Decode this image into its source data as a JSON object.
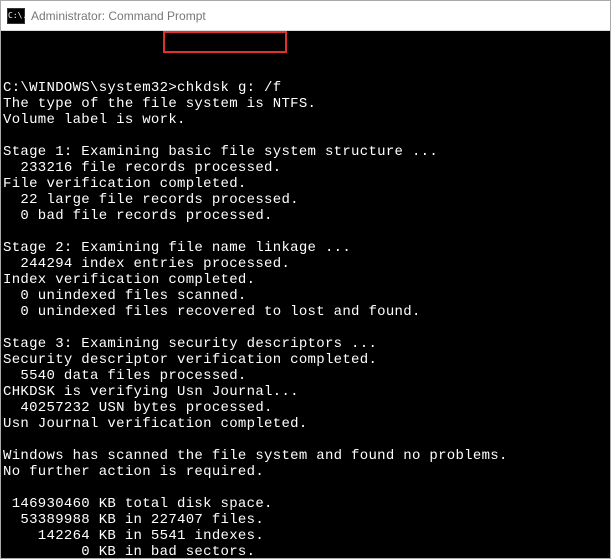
{
  "window": {
    "title": "Administrator: Command Prompt",
    "icon_glyph": "C:\\."
  },
  "terminal": {
    "prompt": "C:\\WINDOWS\\system32>",
    "command": "chkdsk g: /f",
    "lines": [
      "The type of the file system is NTFS.",
      "Volume label is work.",
      "",
      "Stage 1: Examining basic file system structure ...",
      "  233216 file records processed.",
      "File verification completed.",
      "  22 large file records processed.",
      "  0 bad file records processed.",
      "",
      "Stage 2: Examining file name linkage ...",
      "  244294 index entries processed.",
      "Index verification completed.",
      "  0 unindexed files scanned.",
      "  0 unindexed files recovered to lost and found.",
      "",
      "Stage 3: Examining security descriptors ...",
      "Security descriptor verification completed.",
      "  5540 data files processed.",
      "CHKDSK is verifying Usn Journal...",
      "  40257232 USN bytes processed.",
      "Usn Journal verification completed.",
      "",
      "Windows has scanned the file system and found no problems.",
      "No further action is required.",
      "",
      " 146930460 KB total disk space.",
      "  53389988 KB in 227407 files.",
      "    142264 KB in 5541 indexes.",
      "         0 KB in bad sectors."
    ]
  }
}
